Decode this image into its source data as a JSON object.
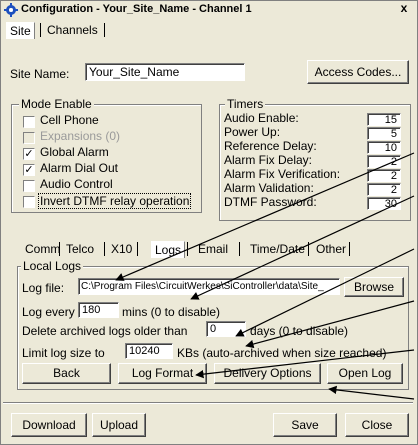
{
  "window": {
    "title": "Configuration - Your_Site_Name - Channel 1",
    "close_label": "x"
  },
  "main_tabs": [
    {
      "label": "Site",
      "selected": true
    },
    {
      "label": "Channels",
      "selected": false
    }
  ],
  "site": {
    "name_label": "Site Name:",
    "name_value": "Your_Site_Name",
    "access_codes_label": "Access Codes..."
  },
  "mode_enable": {
    "title": "Mode Enable",
    "items": [
      {
        "label": "Cell Phone",
        "checked": false,
        "disabled": false
      },
      {
        "label": "Expansions (0)",
        "checked": false,
        "disabled": true
      },
      {
        "label": "Global Alarm",
        "checked": true,
        "disabled": false
      },
      {
        "label": "Alarm Dial Out",
        "checked": true,
        "disabled": false
      },
      {
        "label": "Audio Control",
        "checked": false,
        "disabled": false
      },
      {
        "label": "Invert DTMF relay operation",
        "checked": false,
        "disabled": false
      }
    ]
  },
  "timers": {
    "title": "Timers",
    "items": [
      {
        "label": "Audio Enable:",
        "value": "15"
      },
      {
        "label": "Power Up:",
        "value": "5"
      },
      {
        "label": "Reference Delay:",
        "value": "10"
      },
      {
        "label": "Alarm Fix Delay:",
        "value": "2"
      },
      {
        "label": "Alarm Fix Verification:",
        "value": "2"
      },
      {
        "label": "Alarm Validation:",
        "value": "2"
      },
      {
        "label": "DTMF Password:",
        "value": "30"
      }
    ]
  },
  "sub_tabs": [
    {
      "label": "Comm",
      "selected": false
    },
    {
      "label": "Telco",
      "selected": false
    },
    {
      "label": "X10",
      "selected": false
    },
    {
      "label": "Logs",
      "selected": true
    },
    {
      "label": "Email",
      "selected": false
    },
    {
      "label": "Time/Date",
      "selected": false
    },
    {
      "label": "Other",
      "selected": false
    }
  ],
  "local_logs": {
    "title": "Local Logs",
    "log_file_label": "Log file:",
    "log_file_value": "C:\\Program Files\\CircuitWerkes\\SiController\\data\\Site_",
    "browse_label": "Browse",
    "log_every_label": "Log every",
    "log_every_value": "180",
    "log_every_suffix": "mins (0 to disable)",
    "delete_label": "Delete archived logs older than",
    "delete_value": "0",
    "delete_suffix": "days (0 to disable)",
    "limit_label": "Limit log size to",
    "limit_value": "10240",
    "limit_suffix": "KBs (auto-archived when size reached)",
    "back_label": "Back",
    "log_format_label": "Log Format",
    "delivery_options_label": "Delivery Options",
    "open_log_label": "Open Log"
  },
  "footer": {
    "download_label": "Download",
    "upload_label": "Upload",
    "save_label": "Save",
    "close_label": "Close"
  },
  "colors": {
    "window_bg": "#ece9d8",
    "title_icon": "#1c4fbf"
  }
}
